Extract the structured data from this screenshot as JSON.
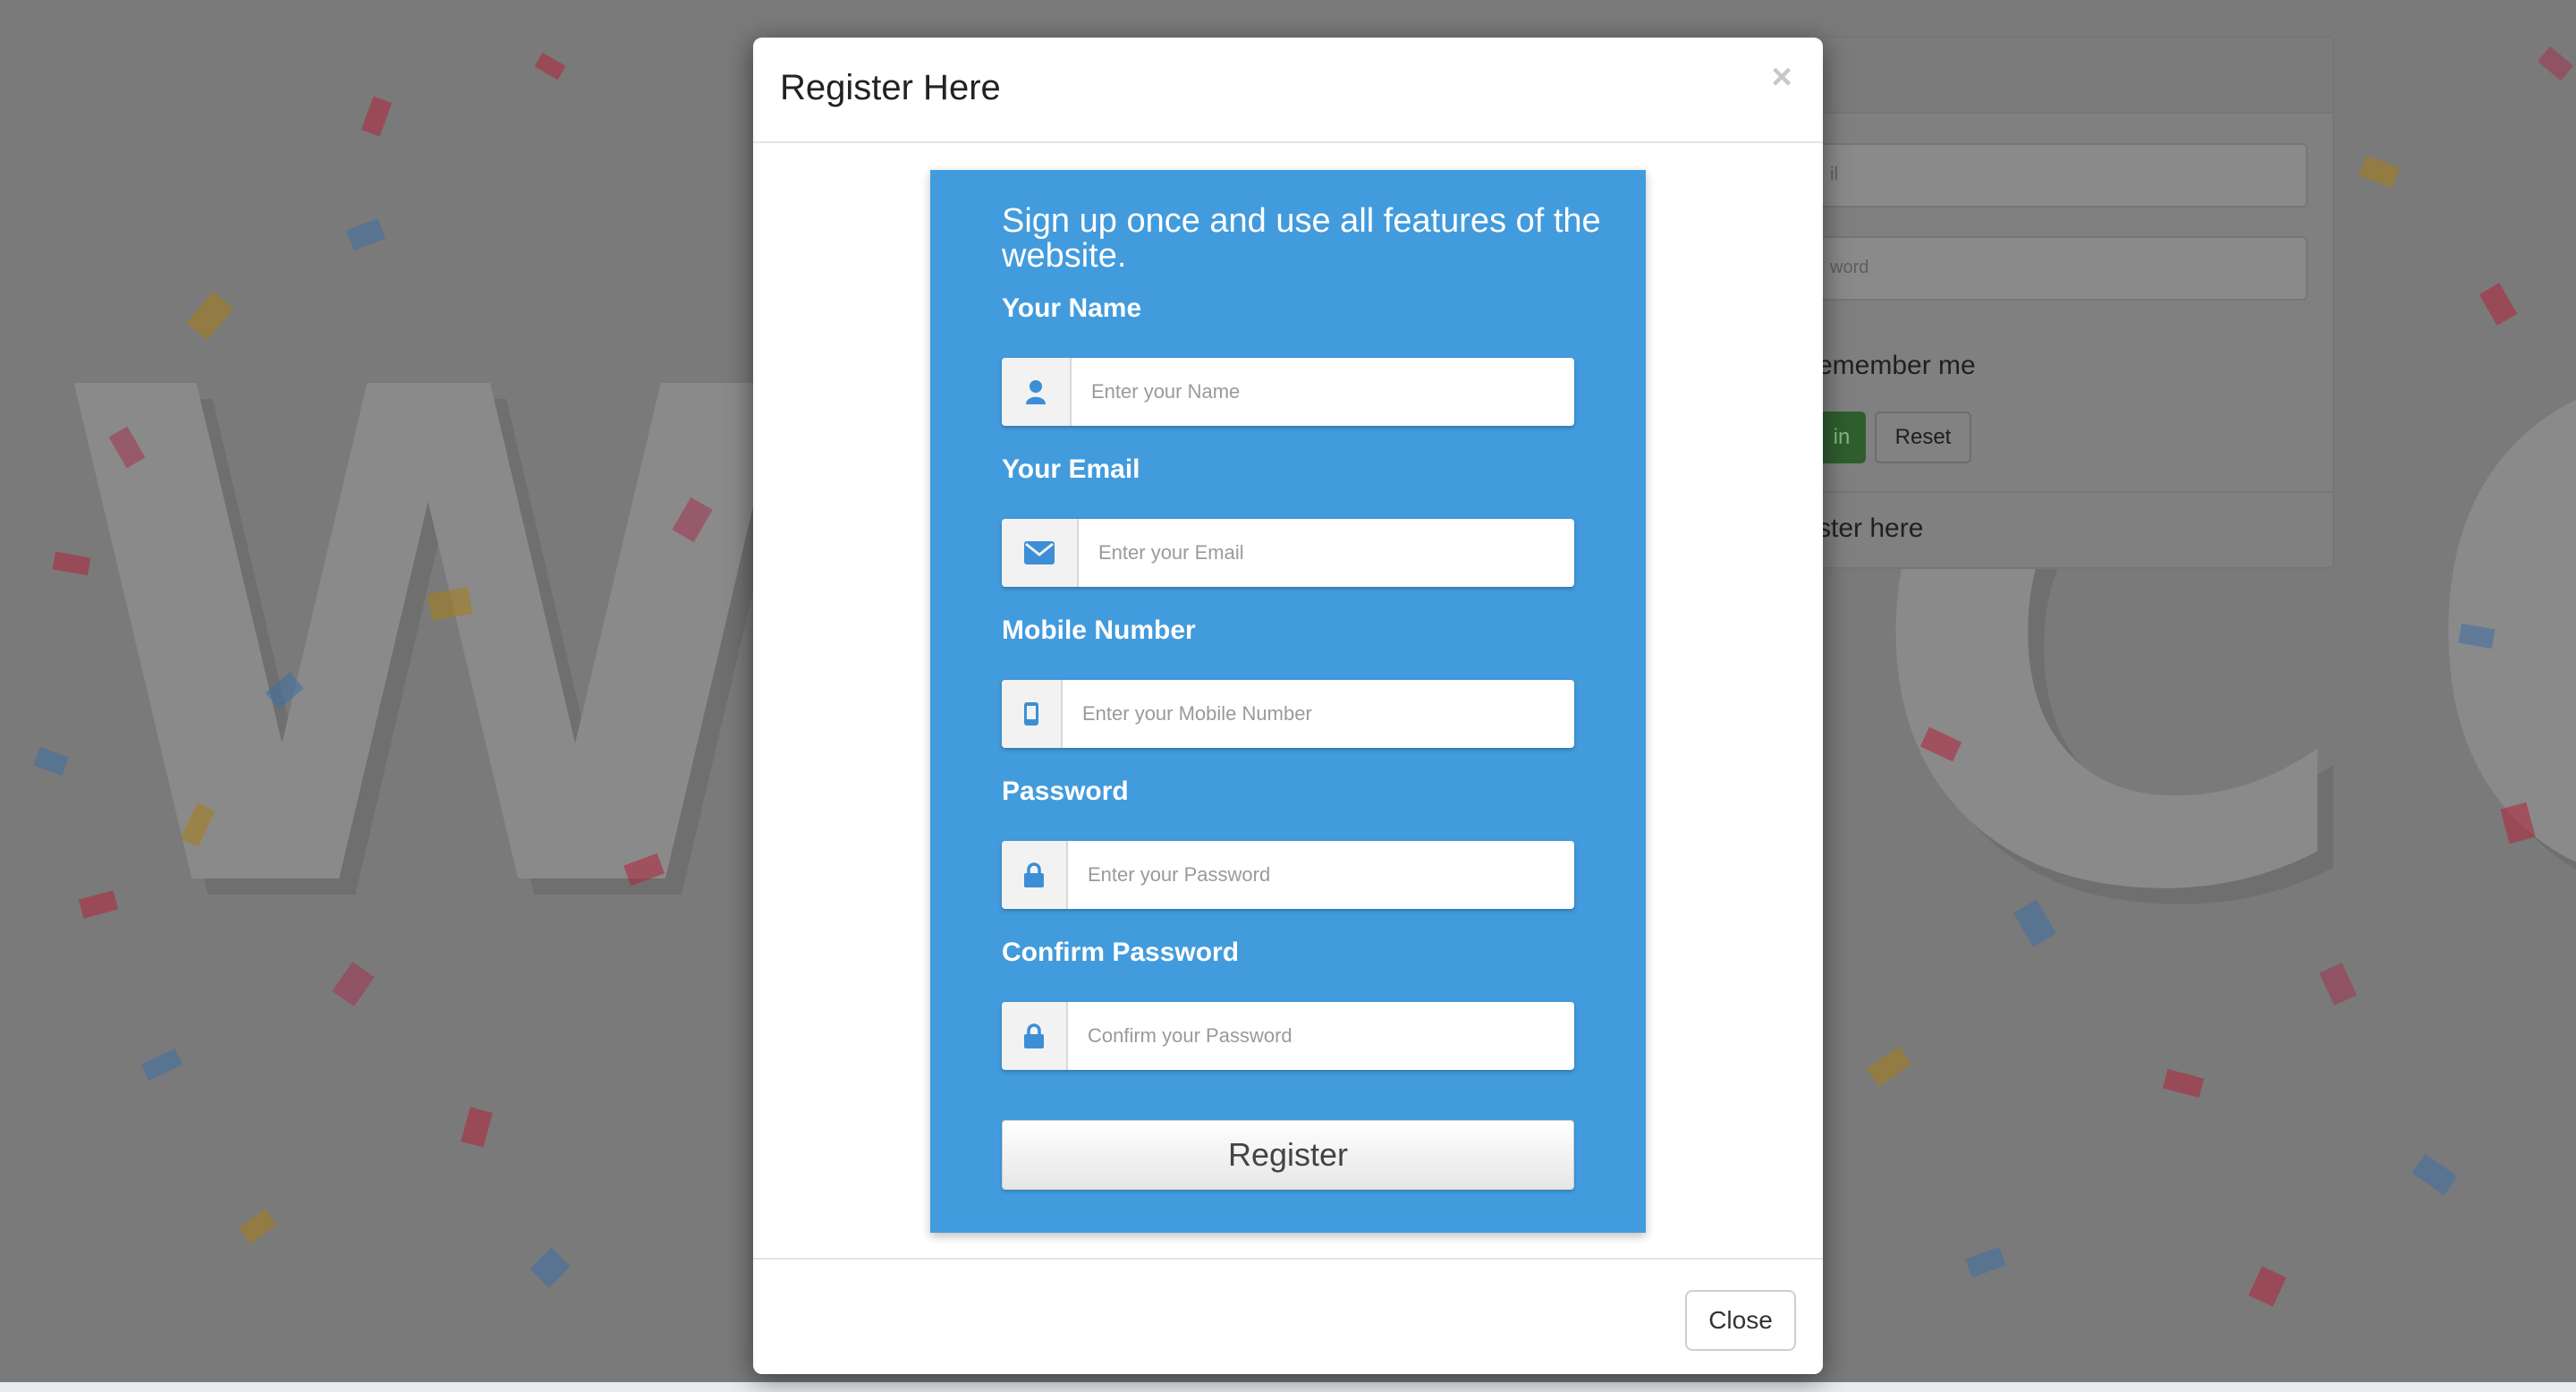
{
  "background": {
    "welcome_text": "WELCOME",
    "login_panel": {
      "email_placeholder": "il",
      "password_placeholder": "word",
      "remember_label": "emember me",
      "signin_label": "in",
      "reset_label": "Reset",
      "register_link": "ster here"
    }
  },
  "modal": {
    "title": "Register Here",
    "close_x": "×",
    "close_button": "Close"
  },
  "form": {
    "intro": "Sign up once and use all features of the website.",
    "fields": [
      {
        "label": "Your Name",
        "placeholder": "Enter your Name",
        "icon": "user-icon"
      },
      {
        "label": "Your Email",
        "placeholder": "Enter your Email",
        "icon": "envelope-icon"
      },
      {
        "label": "Mobile Number",
        "placeholder": "Enter your Mobile Number",
        "icon": "mobile-phone-icon"
      },
      {
        "label": "Password",
        "placeholder": "Enter your Password",
        "icon": "lock-icon"
      },
      {
        "label": "Confirm Password",
        "placeholder": "Confirm your Password",
        "icon": "lock-icon"
      }
    ],
    "submit": "Register"
  },
  "colors": {
    "card_blue": "#429bdc",
    "icon_blue": "#3c8fd6",
    "overlay": "#7a7a7a"
  }
}
